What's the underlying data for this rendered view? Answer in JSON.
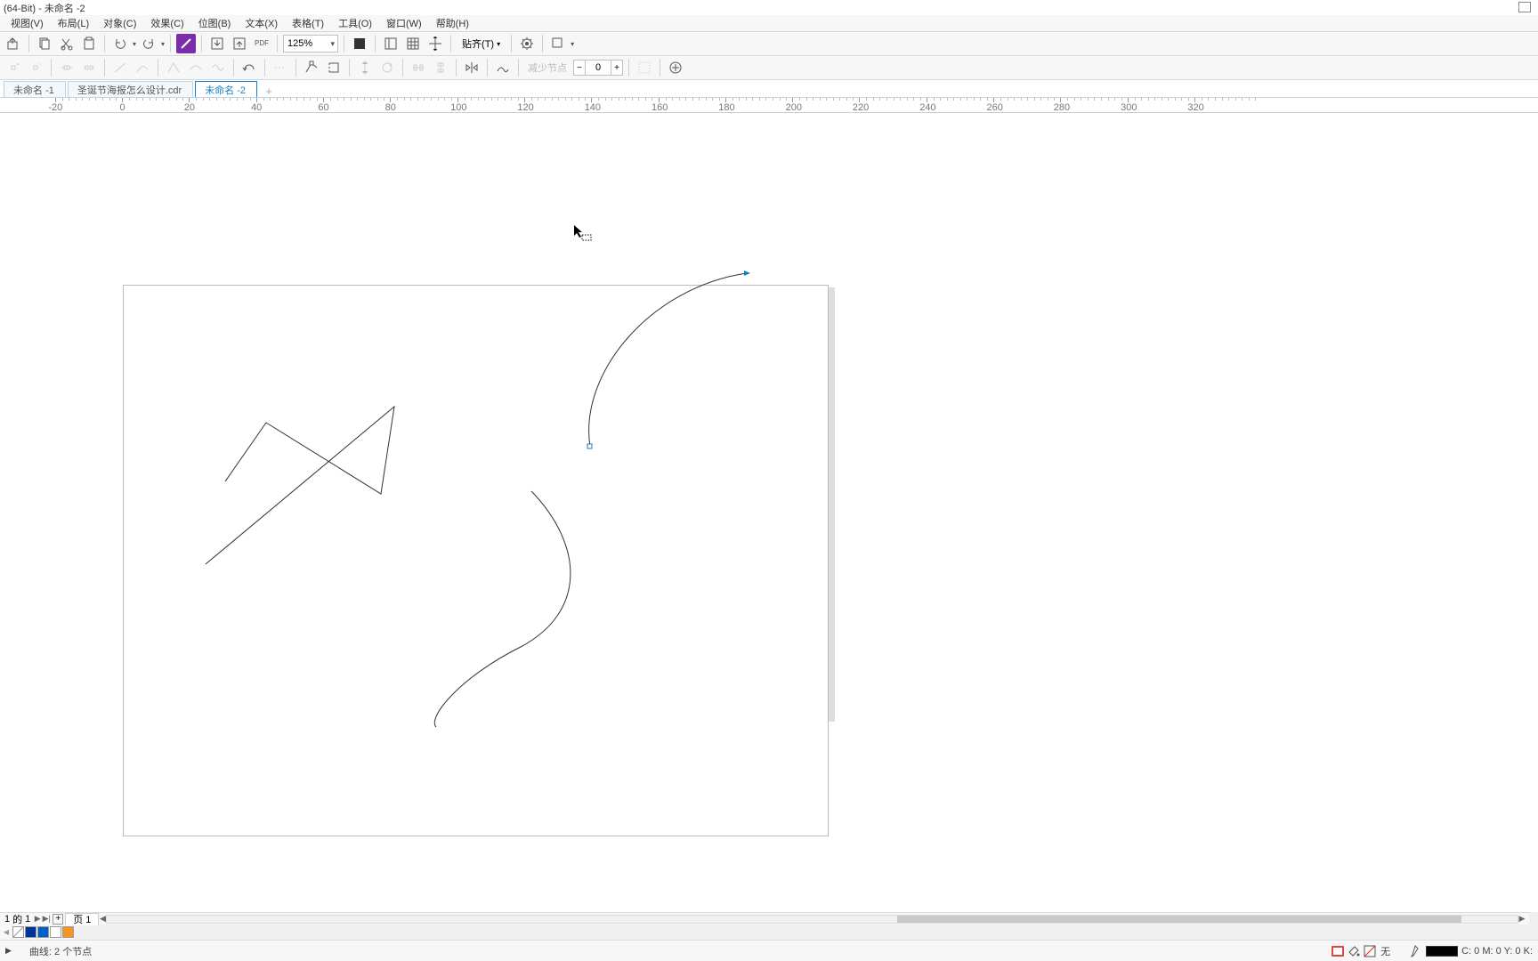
{
  "title": "(64-Bit) - 未命名 -2",
  "menu": {
    "view": "视图(V)",
    "layout": "布局(L)",
    "object": "对象(C)",
    "effect": "效果(C)",
    "bitmap": "位图(B)",
    "text": "文本(X)",
    "table": "表格(T)",
    "tools": "工具(O)",
    "window": "窗口(W)",
    "help": "帮助(H)"
  },
  "toolbar": {
    "zoom": "125%",
    "snap_label": "贴齐(T)",
    "spinner_val": "0"
  },
  "second_toolbar_disabled_text": "减少节点",
  "doc_tabs": [
    "未命名 -1",
    "圣诞节海报怎么设计.cdr",
    "未命名 -2"
  ],
  "active_doc_tab": 2,
  "ruler_ticks": [
    -20,
    0,
    20,
    40,
    60,
    80,
    100,
    120,
    140,
    160,
    180,
    200,
    220,
    240,
    260,
    280,
    300,
    320
  ],
  "page_nav": {
    "of": "的",
    "page_index": "1",
    "page_label": "页 1"
  },
  "palette": [
    "#0033a0",
    "#005ec7",
    "#ffffff",
    "#f7931e"
  ],
  "status": {
    "curve": "曲线: 2 个节点",
    "fill_none": "无",
    "color_readout": "C: 0 M: 0 Y: 0 K:"
  }
}
